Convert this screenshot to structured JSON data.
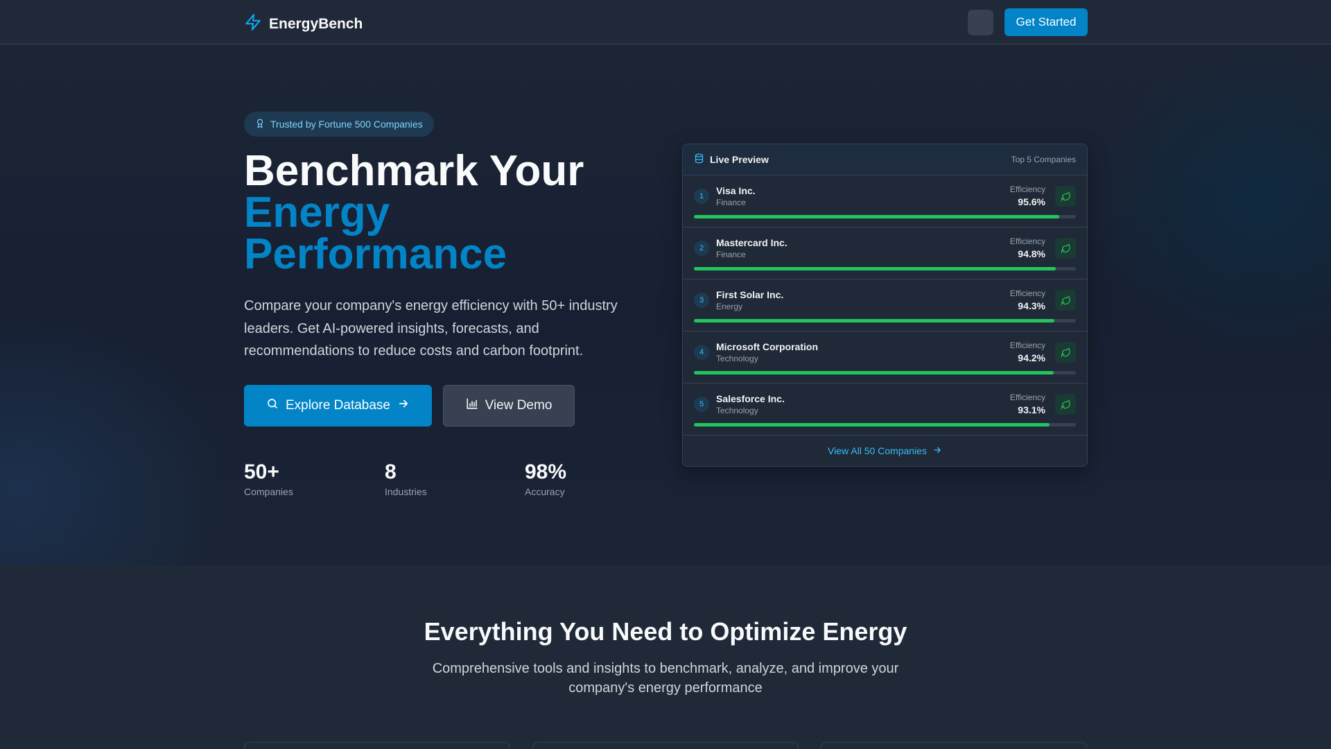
{
  "nav": {
    "brand": "EnergyBench",
    "cta_label": "Get Started"
  },
  "hero": {
    "badge": "Trusted by Fortune 500 Companies",
    "title_line1": "Benchmark Your",
    "title_line2": "Energy",
    "title_line3": "Performance",
    "description": "Compare your company's energy efficiency with 50+ industry leaders. Get AI-powered insights, forecasts, and recommendations to reduce costs and carbon footprint.",
    "primary_button": "Explore Database",
    "secondary_button": "View Demo",
    "stats": [
      {
        "value": "50+",
        "label": "Companies"
      },
      {
        "value": "8",
        "label": "Industries"
      },
      {
        "value": "98%",
        "label": "Accuracy"
      }
    ]
  },
  "preview": {
    "title": "Live Preview",
    "subtitle": "Top 5 Companies",
    "efficiency_label": "Efficiency",
    "companies": [
      {
        "rank": "1",
        "name": "Visa Inc.",
        "industry": "Finance",
        "efficiency": "95.6%",
        "level": 0.956
      },
      {
        "rank": "2",
        "name": "Mastercard Inc.",
        "industry": "Finance",
        "efficiency": "94.8%",
        "level": 0.948
      },
      {
        "rank": "3",
        "name": "First Solar Inc.",
        "industry": "Energy",
        "efficiency": "94.3%",
        "level": 0.943
      },
      {
        "rank": "4",
        "name": "Microsoft Corporation",
        "industry": "Technology",
        "efficiency": "94.2%",
        "level": 0.942
      },
      {
        "rank": "5",
        "name": "Salesforce Inc.",
        "industry": "Technology",
        "efficiency": "93.1%",
        "level": 0.931
      }
    ],
    "footer_link": "View All 50 Companies"
  },
  "features": {
    "title": "Everything You Need to Optimize Energy",
    "subtitle": "Comprehensive tools and insights to benchmark, analyze, and improve your company's energy performance"
  },
  "colors": {
    "accent": "#0284c7",
    "success": "#22c55e",
    "background": "#1f2937"
  },
  "icons": [
    "zap-icon",
    "award-icon",
    "search-icon",
    "arrow-right-icon",
    "bar-chart-icon",
    "database-icon",
    "leaf-icon"
  ]
}
